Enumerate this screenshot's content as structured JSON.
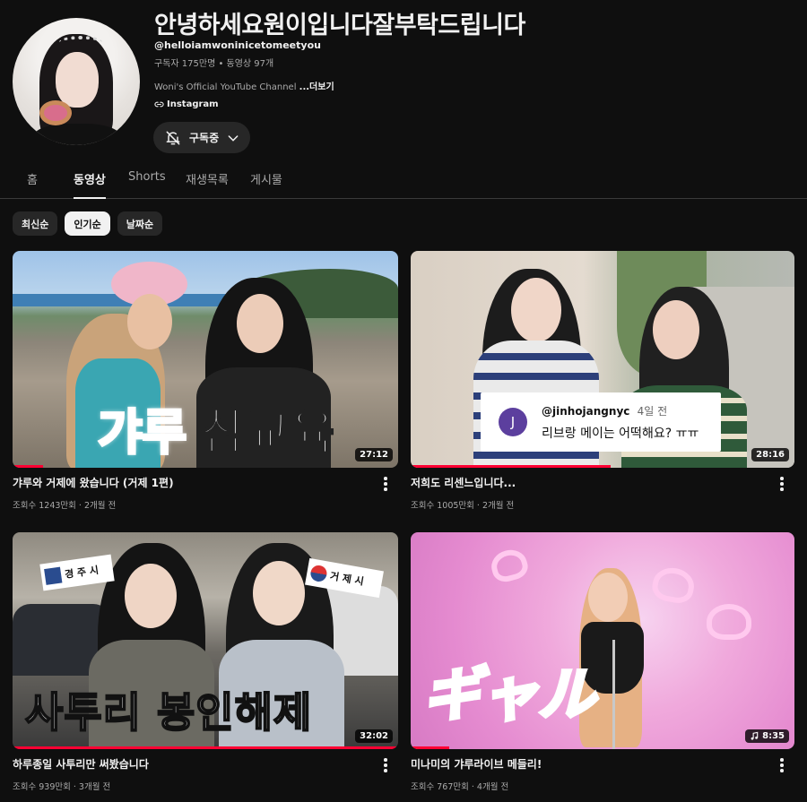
{
  "channel": {
    "title": "안녕하세요원이입니다잘부탁드립니다",
    "handle": "@helloiamwoninicetomeetyou",
    "meta": "구독자 175만명 • 동영상 97개",
    "description": "Woni's Official YouTube Channel ",
    "more_label": "...더보기",
    "link_label": "Instagram",
    "subscribe_label": "구독중"
  },
  "tabs": [
    "홈",
    "동영상",
    "Shorts",
    "재생목록",
    "게시물"
  ],
  "active_tab": "동영상",
  "chips": [
    "최신순",
    "인기순",
    "날짜순"
  ],
  "active_chip": "인기순",
  "videos": [
    {
      "title": "갸루와 거제에 왔습니다 (거제 1편)",
      "meta": "조회수 1243만회 · 2개월 전",
      "duration": "27:12",
      "overlay_text_1": "갸루",
      "overlay_text_2": "참교육",
      "watched_fraction": 0.08
    },
    {
      "title": "저희도 리센느입니다...",
      "meta": "조회수 1005만회 · 2개월 전",
      "duration": "28:16",
      "comment_avatar": "J",
      "comment_user": "@jinhojangnyc",
      "comment_time": "4일 전",
      "comment_text": "리브랑 메이는 어떡해요? ㅠㅠ",
      "watched_fraction": 0.52
    },
    {
      "title": "하루종일 사투리만 써봤습니다",
      "meta": "조회수 939만회 · 3개월 전",
      "duration": "32:02",
      "overlay_text": "사투리 봉인해제",
      "sign_1": "경 주 시",
      "sign_2": "거 제 시",
      "watched_fraction": 1.0
    },
    {
      "title": "미나미의 갸루라이브 메들리!",
      "meta": "조회수 767만회 · 4개월 전",
      "duration": "8:35",
      "overlay_text": "ギャル",
      "watched_fraction": 0.1
    }
  ],
  "colors": {
    "background": "#0f0f0f",
    "chip_bg": "#272727",
    "progress": "#ff0033",
    "text_secondary": "#aaaaaa"
  }
}
